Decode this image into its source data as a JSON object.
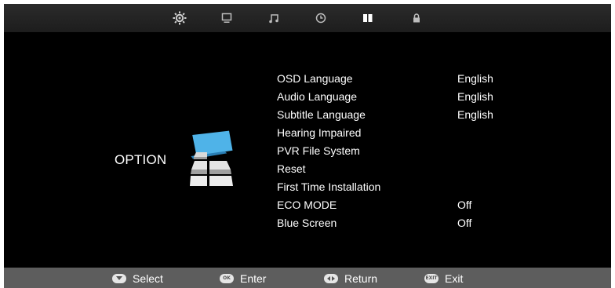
{
  "tabs": [
    {
      "icon": "picture-settings-icon",
      "selected": false
    },
    {
      "icon": "monitor-icon",
      "selected": false
    },
    {
      "icon": "music-note-icon",
      "selected": false
    },
    {
      "icon": "clock-icon",
      "selected": false
    },
    {
      "icon": "option-pages-icon",
      "selected": true
    },
    {
      "icon": "lock-icon",
      "selected": false
    }
  ],
  "section": {
    "title": "OPTION",
    "icon": "option-blocks-icon"
  },
  "menu": [
    {
      "label": "OSD Language",
      "value": "English"
    },
    {
      "label": "Audio Language",
      "value": "English"
    },
    {
      "label": "Subtitle Language",
      "value": "English"
    },
    {
      "label": "Hearing Impaired",
      "value": ""
    },
    {
      "label": "PVR File System",
      "value": ""
    },
    {
      "label": "Reset",
      "value": ""
    },
    {
      "label": "First Time Installation",
      "value": ""
    },
    {
      "label": "ECO MODE",
      "value": "Off"
    },
    {
      "label": "Blue Screen",
      "value": "Off"
    }
  ],
  "footer": {
    "select": {
      "icon": "down-arrow-key-icon",
      "label": "Select"
    },
    "enter": {
      "icon": "ok-key-icon",
      "key_text": "OK",
      "label": "Enter"
    },
    "return": {
      "icon": "left-right-key-icon",
      "label": "Return"
    },
    "exit": {
      "icon": "exit-key-icon",
      "key_text": "EXIT",
      "label": "Exit"
    }
  },
  "colors": {
    "background": "#000000",
    "footer": "#5d5d5d",
    "accent_blue": "#4fb3e8",
    "text": "#ffffff"
  }
}
